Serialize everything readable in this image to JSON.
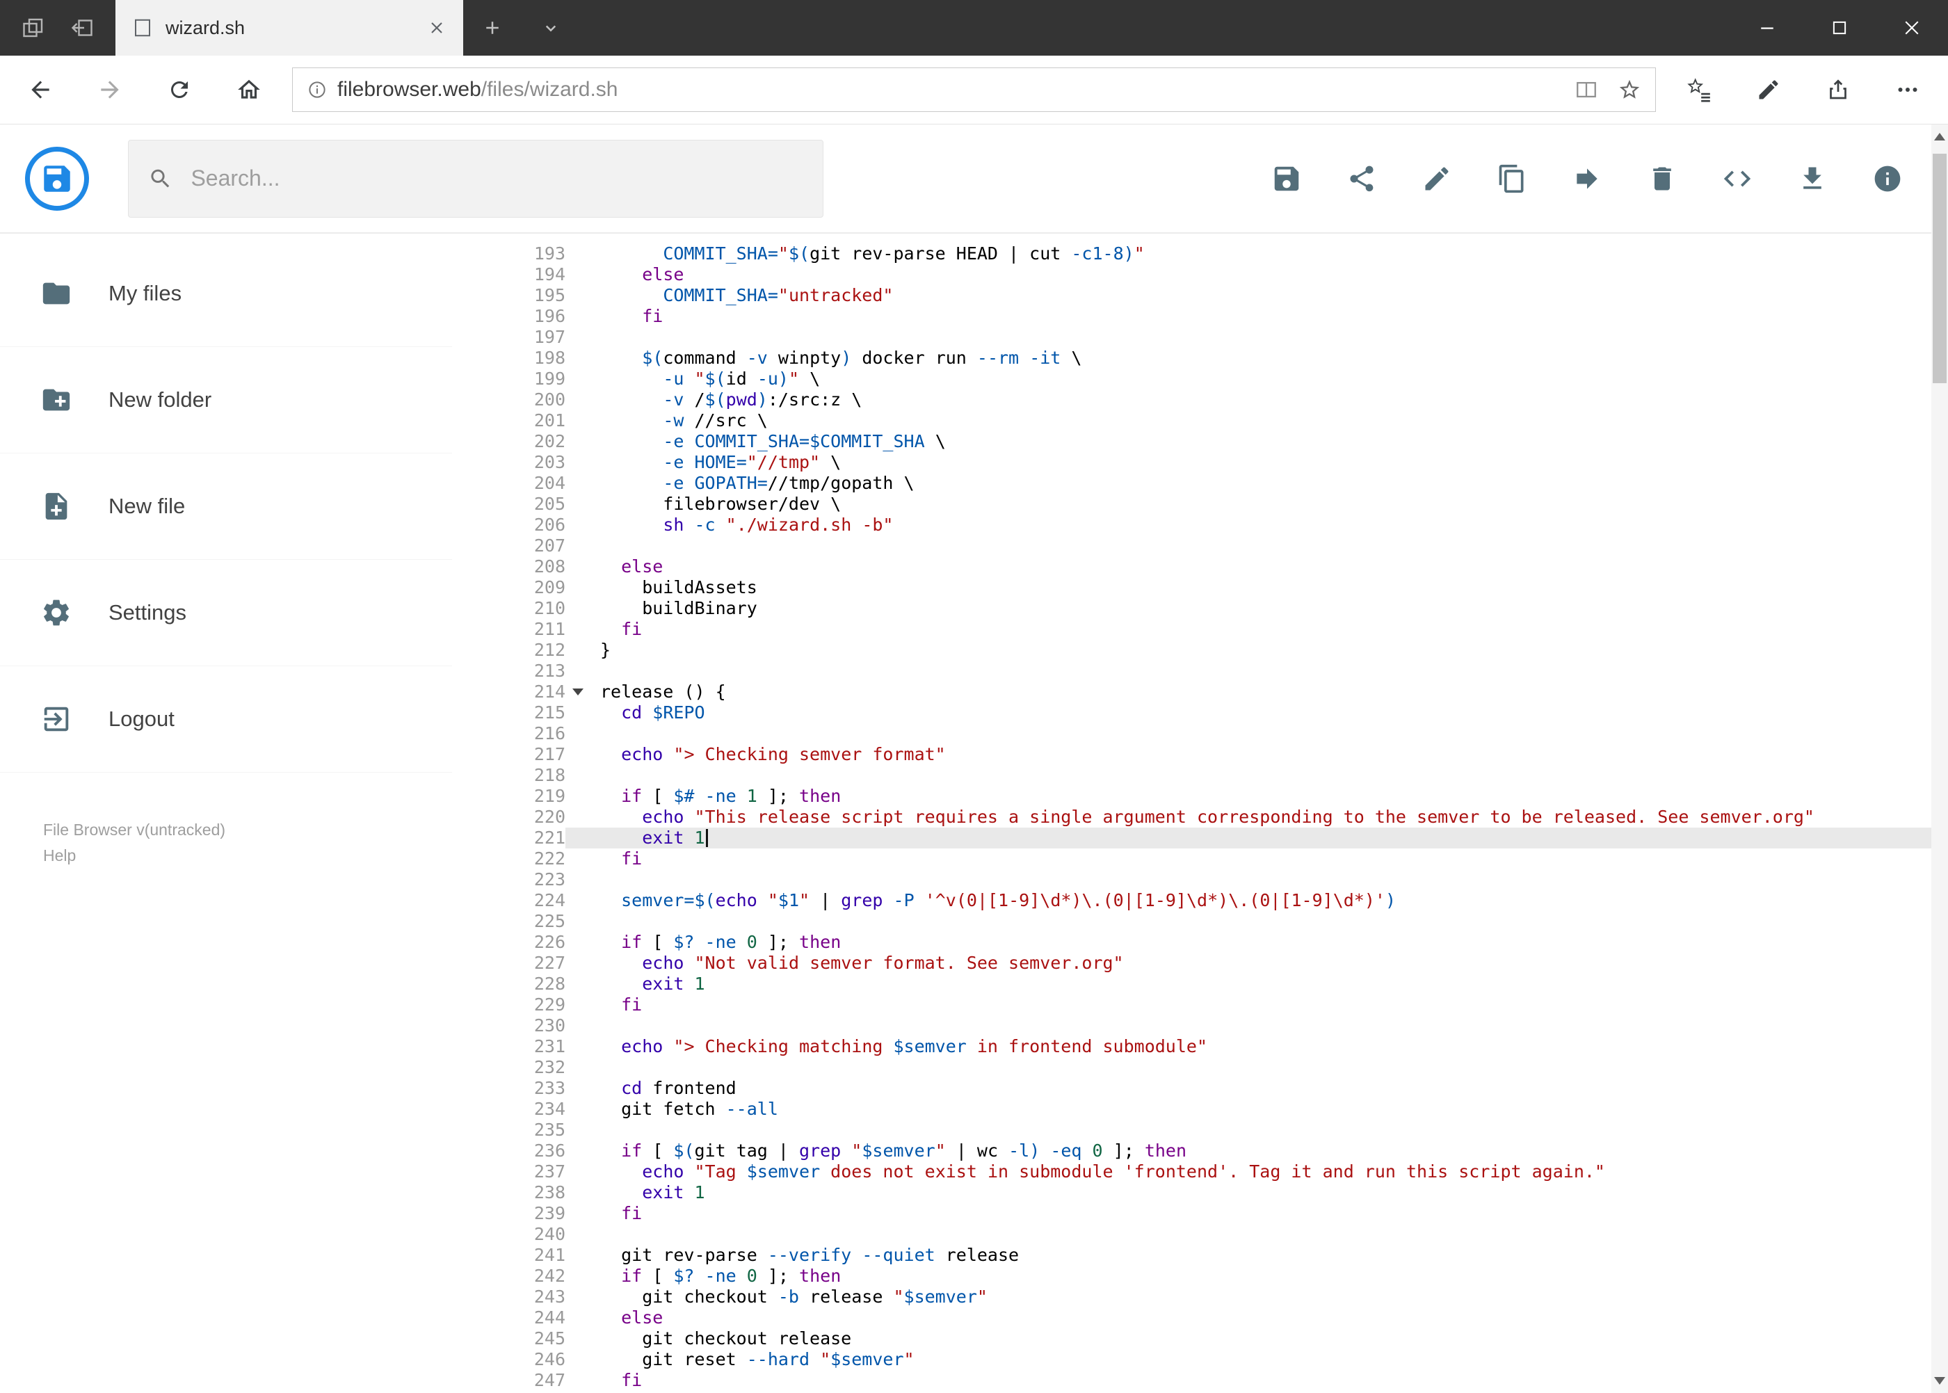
{
  "browser": {
    "tab_title": "wizard.sh",
    "address": {
      "domain": "filebrowser.web",
      "path": "/files/wizard.sh"
    },
    "tabbar_icons": [
      "tabs-set-aside",
      "set-tabs-aside",
      "document",
      "tab-close",
      "new-tab-plus",
      "chevron-down"
    ],
    "window_controls": [
      "minimize",
      "maximize",
      "close"
    ],
    "nav_icons": [
      "back",
      "forward",
      "refresh",
      "home",
      "page-info",
      "reading-view",
      "favorite-star",
      "hub",
      "web-notes",
      "share",
      "more"
    ]
  },
  "app": {
    "search": {
      "placeholder": "Search..."
    },
    "toolbar_icons": [
      "save",
      "share",
      "rename",
      "copy",
      "move",
      "delete",
      "source-code",
      "download",
      "info"
    ],
    "accent_color": "#1e88e5",
    "icon_color": "#546e7a",
    "sidebar": {
      "items": [
        {
          "icon": "folder",
          "label": "My files"
        },
        {
          "icon": "new-folder",
          "label": "New folder"
        },
        {
          "icon": "new-file",
          "label": "New file"
        },
        {
          "icon": "settings-gear",
          "label": "Settings"
        },
        {
          "icon": "logout",
          "label": "Logout"
        }
      ],
      "footer": {
        "version": "File Browser v(untracked)",
        "help": "Help"
      }
    }
  },
  "editor": {
    "active_line": 221,
    "fold_line": 214,
    "colors": {
      "keyword": "#708",
      "string": "#a11",
      "variable": "#05a",
      "number": "#164",
      "builtin": "#30a"
    },
    "lines": [
      {
        "n": 193,
        "t": [
          [
            "",
            "      "
          ],
          [
            "v",
            "COMMIT_SHA="
          ],
          [
            "s",
            "\""
          ],
          [
            "v",
            "$("
          ],
          [
            "",
            "git rev-parse HEAD | cut "
          ],
          [
            "v",
            "-c1-8"
          ],
          [
            "v",
            ")"
          ],
          [
            "s",
            "\""
          ]
        ]
      },
      {
        "n": 194,
        "t": [
          [
            "",
            "    "
          ],
          [
            "k",
            "else"
          ]
        ]
      },
      {
        "n": 195,
        "t": [
          [
            "",
            "      "
          ],
          [
            "v",
            "COMMIT_SHA="
          ],
          [
            "s",
            "\"untracked\""
          ]
        ]
      },
      {
        "n": 196,
        "t": [
          [
            "",
            "    "
          ],
          [
            "k",
            "fi"
          ]
        ]
      },
      {
        "n": 197,
        "t": []
      },
      {
        "n": 198,
        "t": [
          [
            "",
            "    "
          ],
          [
            "v",
            "$("
          ],
          [
            "",
            "command "
          ],
          [
            "v",
            "-v"
          ],
          [
            "",
            " winpty"
          ],
          [
            "v",
            ")"
          ],
          [
            "",
            " docker run "
          ],
          [
            "v",
            "--rm"
          ],
          [
            "",
            " "
          ],
          [
            "v",
            "-it"
          ],
          [
            "",
            " \\"
          ]
        ]
      },
      {
        "n": 199,
        "t": [
          [
            "",
            "      "
          ],
          [
            "v",
            "-u"
          ],
          [
            "",
            " "
          ],
          [
            "s",
            "\""
          ],
          [
            "v",
            "$("
          ],
          [
            "",
            "id "
          ],
          [
            "v",
            "-u"
          ],
          [
            "v",
            ")"
          ],
          [
            "s",
            "\""
          ],
          [
            "",
            " \\"
          ]
        ]
      },
      {
        "n": 200,
        "t": [
          [
            "",
            "      "
          ],
          [
            "v",
            "-v"
          ],
          [
            "",
            " /"
          ],
          [
            "v",
            "$("
          ],
          [
            "b",
            "pwd"
          ],
          [
            "v",
            ")"
          ],
          [
            "",
            ":/src:z \\"
          ]
        ]
      },
      {
        "n": 201,
        "t": [
          [
            "",
            "      "
          ],
          [
            "v",
            "-w"
          ],
          [
            "",
            " //src \\"
          ]
        ]
      },
      {
        "n": 202,
        "t": [
          [
            "",
            "      "
          ],
          [
            "v",
            "-e"
          ],
          [
            "",
            " "
          ],
          [
            "v",
            "COMMIT_SHA="
          ],
          [
            "v",
            "$COMMIT_SHA"
          ],
          [
            "",
            " \\"
          ]
        ]
      },
      {
        "n": 203,
        "t": [
          [
            "",
            "      "
          ],
          [
            "v",
            "-e"
          ],
          [
            "",
            " "
          ],
          [
            "v",
            "HOME="
          ],
          [
            "s",
            "\"//tmp\""
          ],
          [
            "",
            " \\"
          ]
        ]
      },
      {
        "n": 204,
        "t": [
          [
            "",
            "      "
          ],
          [
            "v",
            "-e"
          ],
          [
            "",
            " "
          ],
          [
            "v",
            "GOPATH="
          ],
          [
            "",
            "//tmp/gopath \\"
          ]
        ]
      },
      {
        "n": 205,
        "t": [
          [
            "",
            "      filebrowser/dev \\"
          ]
        ]
      },
      {
        "n": 206,
        "t": [
          [
            "",
            "      "
          ],
          [
            "b",
            "sh"
          ],
          [
            "",
            " "
          ],
          [
            "v",
            "-c"
          ],
          [
            "",
            " "
          ],
          [
            "s",
            "\"./wizard.sh -b\""
          ]
        ]
      },
      {
        "n": 207,
        "t": []
      },
      {
        "n": 208,
        "t": [
          [
            "",
            "  "
          ],
          [
            "k",
            "else"
          ]
        ]
      },
      {
        "n": 209,
        "t": [
          [
            "",
            "    buildAssets"
          ]
        ]
      },
      {
        "n": 210,
        "t": [
          [
            "",
            "    buildBinary"
          ]
        ]
      },
      {
        "n": 211,
        "t": [
          [
            "",
            "  "
          ],
          [
            "k",
            "fi"
          ]
        ]
      },
      {
        "n": 212,
        "t": [
          [
            "",
            "}"
          ]
        ]
      },
      {
        "n": 213,
        "t": []
      },
      {
        "n": 214,
        "fold": true,
        "t": [
          [
            "",
            "release () {"
          ]
        ]
      },
      {
        "n": 215,
        "t": [
          [
            "",
            "  "
          ],
          [
            "b",
            "cd"
          ],
          [
            "",
            " "
          ],
          [
            "v",
            "$REPO"
          ]
        ]
      },
      {
        "n": 216,
        "t": []
      },
      {
        "n": 217,
        "t": [
          [
            "",
            "  "
          ],
          [
            "b",
            "echo"
          ],
          [
            "",
            " "
          ],
          [
            "s",
            "\"> Checking semver format\""
          ]
        ]
      },
      {
        "n": 218,
        "t": []
      },
      {
        "n": 219,
        "t": [
          [
            "",
            "  "
          ],
          [
            "k",
            "if"
          ],
          [
            "",
            " [ "
          ],
          [
            "v",
            "$#"
          ],
          [
            "",
            " "
          ],
          [
            "v",
            "-ne"
          ],
          [
            "",
            " "
          ],
          [
            "n",
            "1"
          ],
          [
            "",
            " ]; "
          ],
          [
            "k",
            "then"
          ]
        ]
      },
      {
        "n": 220,
        "t": [
          [
            "",
            "    "
          ],
          [
            "b",
            "echo"
          ],
          [
            "",
            " "
          ],
          [
            "s",
            "\"This release script requires a single argument corresponding to the semver to be released. See semver.org\""
          ]
        ]
      },
      {
        "n": 221,
        "cursor": true,
        "t": [
          [
            "",
            "    "
          ],
          [
            "b",
            "exit"
          ],
          [
            "",
            " "
          ],
          [
            "n",
            "1"
          ]
        ]
      },
      {
        "n": 222,
        "t": [
          [
            "",
            "  "
          ],
          [
            "k",
            "fi"
          ]
        ]
      },
      {
        "n": 223,
        "t": []
      },
      {
        "n": 224,
        "t": [
          [
            "",
            "  "
          ],
          [
            "v",
            "semver="
          ],
          [
            "v",
            "$("
          ],
          [
            "b",
            "echo"
          ],
          [
            "",
            " "
          ],
          [
            "s",
            "\""
          ],
          [
            "v",
            "$1"
          ],
          [
            "s",
            "\""
          ],
          [
            "",
            " | "
          ],
          [
            "b",
            "grep"
          ],
          [
            "",
            " "
          ],
          [
            "v",
            "-P"
          ],
          [
            "",
            " "
          ],
          [
            "s",
            "'^v(0|[1-9]\\d*)\\.(0|[1-9]\\d*)\\.(0|[1-9]\\d*)'"
          ],
          [
            "v",
            ")"
          ]
        ]
      },
      {
        "n": 225,
        "t": []
      },
      {
        "n": 226,
        "t": [
          [
            "",
            "  "
          ],
          [
            "k",
            "if"
          ],
          [
            "",
            " [ "
          ],
          [
            "v",
            "$?"
          ],
          [
            "",
            " "
          ],
          [
            "v",
            "-ne"
          ],
          [
            "",
            " "
          ],
          [
            "n",
            "0"
          ],
          [
            "",
            " ]; "
          ],
          [
            "k",
            "then"
          ]
        ]
      },
      {
        "n": 227,
        "t": [
          [
            "",
            "    "
          ],
          [
            "b",
            "echo"
          ],
          [
            "",
            " "
          ],
          [
            "s",
            "\"Not valid semver format. See semver.org\""
          ]
        ]
      },
      {
        "n": 228,
        "t": [
          [
            "",
            "    "
          ],
          [
            "b",
            "exit"
          ],
          [
            "",
            " "
          ],
          [
            "n",
            "1"
          ]
        ]
      },
      {
        "n": 229,
        "t": [
          [
            "",
            "  "
          ],
          [
            "k",
            "fi"
          ]
        ]
      },
      {
        "n": 230,
        "t": []
      },
      {
        "n": 231,
        "t": [
          [
            "",
            "  "
          ],
          [
            "b",
            "echo"
          ],
          [
            "",
            " "
          ],
          [
            "s",
            "\"> Checking matching "
          ],
          [
            "v",
            "$semver"
          ],
          [
            "s",
            " in frontend submodule\""
          ]
        ]
      },
      {
        "n": 232,
        "t": []
      },
      {
        "n": 233,
        "t": [
          [
            "",
            "  "
          ],
          [
            "b",
            "cd"
          ],
          [
            "",
            " frontend"
          ]
        ]
      },
      {
        "n": 234,
        "t": [
          [
            "",
            "  git fetch "
          ],
          [
            "v",
            "--all"
          ]
        ]
      },
      {
        "n": 235,
        "t": []
      },
      {
        "n": 236,
        "t": [
          [
            "",
            "  "
          ],
          [
            "k",
            "if"
          ],
          [
            "",
            " [ "
          ],
          [
            "v",
            "$("
          ],
          [
            "",
            "git tag | "
          ],
          [
            "b",
            "grep"
          ],
          [
            "",
            " "
          ],
          [
            "s",
            "\""
          ],
          [
            "v",
            "$semver"
          ],
          [
            "s",
            "\""
          ],
          [
            "",
            " | wc "
          ],
          [
            "v",
            "-l"
          ],
          [
            "v",
            ")"
          ],
          [
            "",
            " "
          ],
          [
            "v",
            "-eq"
          ],
          [
            "",
            " "
          ],
          [
            "n",
            "0"
          ],
          [
            "",
            " ]; "
          ],
          [
            "k",
            "then"
          ]
        ]
      },
      {
        "n": 237,
        "t": [
          [
            "",
            "    "
          ],
          [
            "b",
            "echo"
          ],
          [
            "",
            " "
          ],
          [
            "s",
            "\"Tag "
          ],
          [
            "v",
            "$semver"
          ],
          [
            "s",
            " does not exist in submodule 'frontend'. Tag it and run this script again.\""
          ]
        ]
      },
      {
        "n": 238,
        "t": [
          [
            "",
            "    "
          ],
          [
            "b",
            "exit"
          ],
          [
            "",
            " "
          ],
          [
            "n",
            "1"
          ]
        ]
      },
      {
        "n": 239,
        "t": [
          [
            "",
            "  "
          ],
          [
            "k",
            "fi"
          ]
        ]
      },
      {
        "n": 240,
        "t": []
      },
      {
        "n": 241,
        "t": [
          [
            "",
            "  git rev-parse "
          ],
          [
            "v",
            "--verify"
          ],
          [
            "",
            " "
          ],
          [
            "v",
            "--quiet"
          ],
          [
            "",
            " release"
          ]
        ]
      },
      {
        "n": 242,
        "t": [
          [
            "",
            "  "
          ],
          [
            "k",
            "if"
          ],
          [
            "",
            " [ "
          ],
          [
            "v",
            "$?"
          ],
          [
            "",
            " "
          ],
          [
            "v",
            "-ne"
          ],
          [
            "",
            " "
          ],
          [
            "n",
            "0"
          ],
          [
            "",
            " ]; "
          ],
          [
            "k",
            "then"
          ]
        ]
      },
      {
        "n": 243,
        "t": [
          [
            "",
            "    git checkout "
          ],
          [
            "v",
            "-b"
          ],
          [
            "",
            " release "
          ],
          [
            "s",
            "\""
          ],
          [
            "v",
            "$semver"
          ],
          [
            "s",
            "\""
          ]
        ]
      },
      {
        "n": 244,
        "t": [
          [
            "",
            "  "
          ],
          [
            "k",
            "else"
          ]
        ]
      },
      {
        "n": 245,
        "t": [
          [
            "",
            "    git checkout release"
          ]
        ]
      },
      {
        "n": 246,
        "t": [
          [
            "",
            "    git reset "
          ],
          [
            "v",
            "--hard"
          ],
          [
            "",
            " "
          ],
          [
            "s",
            "\""
          ],
          [
            "v",
            "$semver"
          ],
          [
            "s",
            "\""
          ]
        ]
      },
      {
        "n": 247,
        "t": [
          [
            "",
            "  "
          ],
          [
            "k",
            "fi"
          ]
        ]
      }
    ]
  }
}
